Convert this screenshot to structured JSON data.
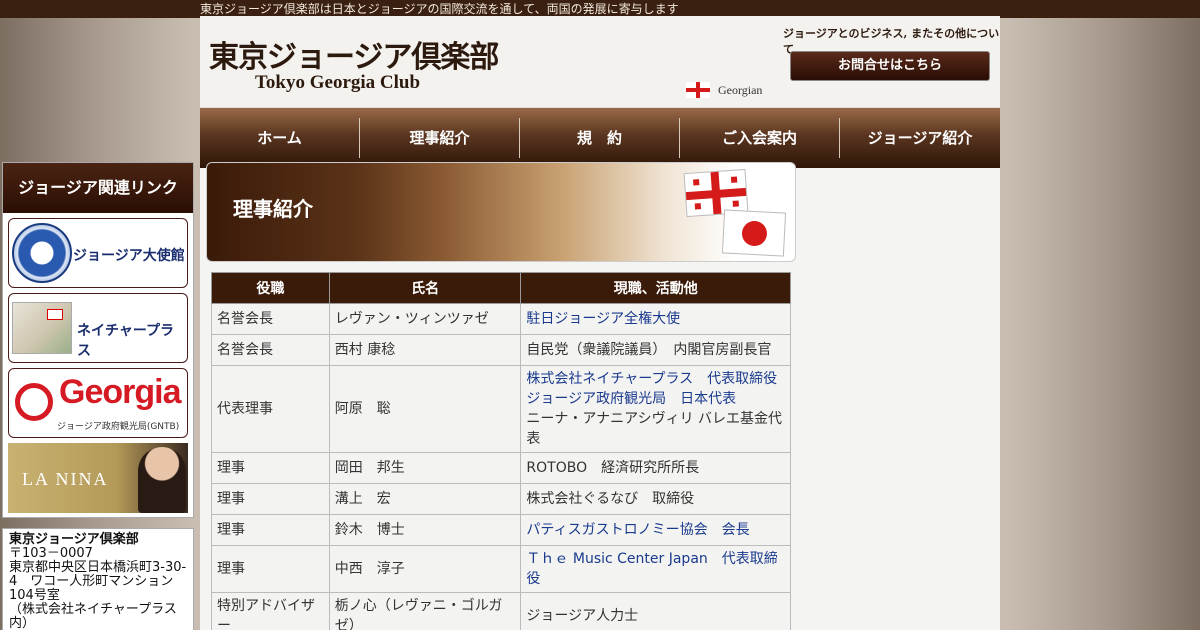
{
  "top_bar": {
    "text": "東京ジョージア倶楽部は日本とジョージアの国際交流を通して、両国の発展に寄与します"
  },
  "header": {
    "logo_jp": "東京ジョージア倶楽部",
    "logo_en": "Tokyo Georgia Club",
    "georgian_link": "Georgian",
    "biz_note": "ジョージアとのビジネス, またその他について",
    "contact_button": "お問合せはこちら"
  },
  "nav": {
    "items": [
      {
        "label": "ホーム"
      },
      {
        "label": "理事紹介"
      },
      {
        "label": "規　約"
      },
      {
        "label": "ご入会案内"
      },
      {
        "label": "ジョージア紹介"
      }
    ]
  },
  "sidebar": {
    "title": "ジョージア関連リンク",
    "links": [
      {
        "label": "ジョージア大使館"
      },
      {
        "label": "ネイチャープラス"
      },
      {
        "label": "Georgia",
        "sub": "ジョージア政府観光局(GNTB)"
      },
      {
        "label": "LA NINA"
      }
    ],
    "address": {
      "name": "東京ジョージア倶楽部",
      "postal": "〒103－0007",
      "line1": "東京都中央区日本橋浜町3-30-4　ワコー人形町マンション104号室",
      "line2": "（株式会社ネイチャープラス内）"
    }
  },
  "main": {
    "banner_title": "理事紹介",
    "table": {
      "headers": [
        "役職",
        "氏名",
        "現職、活動他"
      ],
      "rows": [
        {
          "role": "名誉会長",
          "name": "レヴァン・ツィンツァゼ",
          "lines": [
            {
              "text": "駐日ジョージア全権大使",
              "link": true
            }
          ]
        },
        {
          "role": "名誉会長",
          "name": "西村 康稔",
          "lines": [
            {
              "text": "自民党（衆議院議員）　内閣官房副長官",
              "link": false
            }
          ]
        },
        {
          "role": "代表理事",
          "name": "阿原　聡",
          "lines": [
            {
              "text": "株式会社ネイチャープラス　代表取締役",
              "link": true
            },
            {
              "text": "ジョージア政府観光局　日本代表",
              "link": true
            },
            {
              "text": "ニーナ・アナニアシヴィリ バレエ基金代表",
              "link": false
            }
          ]
        },
        {
          "role": "理事",
          "name": "岡田　邦生",
          "lines": [
            {
              "text": "ROTOBO　経済研究所所長",
              "link": false
            }
          ]
        },
        {
          "role": "理事",
          "name": "溝上　宏",
          "lines": [
            {
              "text": "株式会社ぐるなび　取締役",
              "link": false
            }
          ]
        },
        {
          "role": "理事",
          "name": "鈴木　博士",
          "lines": [
            {
              "text": "パティスガストロノミー協会　会長",
              "link": true
            }
          ]
        },
        {
          "role": "理事",
          "name": "中西　淳子",
          "lines": [
            {
              "text": "Ｔｈｅ Music Center Japan　代表取締役",
              "link": true
            }
          ]
        },
        {
          "role": "特別アドバイザー",
          "name": "栃ノ心（レヴァニ・ゴルガゼ）",
          "lines": [
            {
              "text": "ジョージア人力士",
              "link": false
            }
          ]
        }
      ]
    }
  }
}
